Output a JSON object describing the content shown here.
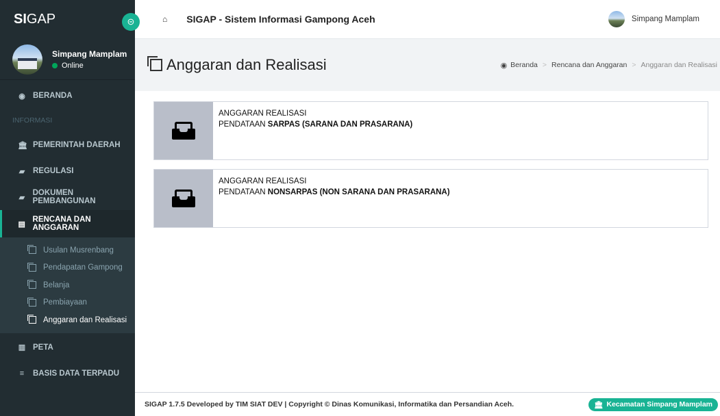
{
  "brand": {
    "bold": "SI",
    "rest": "GAP"
  },
  "user": {
    "name": "Simpang Mamplam",
    "status": "Online"
  },
  "sidebar": {
    "beranda": "BERANDA",
    "header_info": "INFORMASI",
    "items": [
      {
        "label": "PEMERINTAH DAERAH",
        "icon": "bank-icon"
      },
      {
        "label": "REGULASI",
        "icon": "book-icon"
      },
      {
        "label": "DOKUMEN PEMBANGUNAN",
        "icon": "book-icon"
      },
      {
        "label": "RENCANA DAN ANGGARAN",
        "icon": "file-icon"
      }
    ],
    "submenu": [
      "Usulan Musrenbang",
      "Pendapatan Gampong",
      "Belanja",
      "Pembiayaan",
      "Anggaran dan Realisasi"
    ],
    "peta": "PETA",
    "basis": "BASIS DATA TERPADU"
  },
  "topbar": {
    "title": "SIGAP - Sistem Informasi Gampong Aceh",
    "user": "Simpang Mamplam"
  },
  "page": {
    "title": "Anggaran dan Realisasi"
  },
  "breadcrumb": [
    "Beranda",
    "Rencana dan Anggaran",
    "Anggaran dan Realisasi"
  ],
  "boxes": [
    {
      "line1": "ANGGARAN REALISASI",
      "prefix": "PENDATAAN ",
      "bold": "SARPAS (SARANA DAN PRASARANA)"
    },
    {
      "line1": "ANGGARAN REALISASI",
      "prefix": "PENDATAAN ",
      "bold": "NONSARPAS (NON SARANA DAN PRASARANA)"
    }
  ],
  "footer": {
    "text": "SIGAP 1.7.5 Developed by TIM SIAT DEV | Copyright © Dinas Komunikasi, Informatika dan Persandian Aceh.",
    "badge": "Kecamatan Simpang Mamplam"
  },
  "colors": {
    "accent": "#19b394",
    "sidebar": "#222d32"
  }
}
